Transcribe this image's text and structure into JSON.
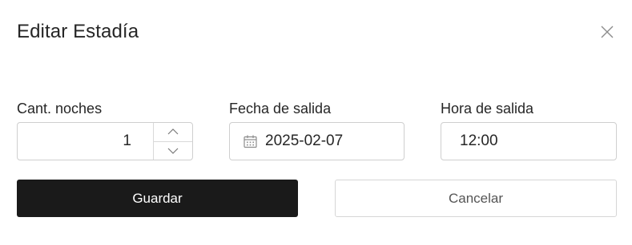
{
  "dialog": {
    "title": "Editar Estadía",
    "close_icon": "close-icon"
  },
  "fields": {
    "nights": {
      "label": "Cant. noches",
      "value": "1"
    },
    "checkout_date": {
      "label": "Fecha de salida",
      "value": "2025-02-07",
      "icon": "calendar-icon"
    },
    "checkout_time": {
      "label": "Hora de salida",
      "value": "12:00"
    }
  },
  "actions": {
    "save_label": "Guardar",
    "cancel_label": "Cancelar"
  },
  "colors": {
    "primary_button": "#1a1a1a",
    "border": "#cfcfcf"
  }
}
